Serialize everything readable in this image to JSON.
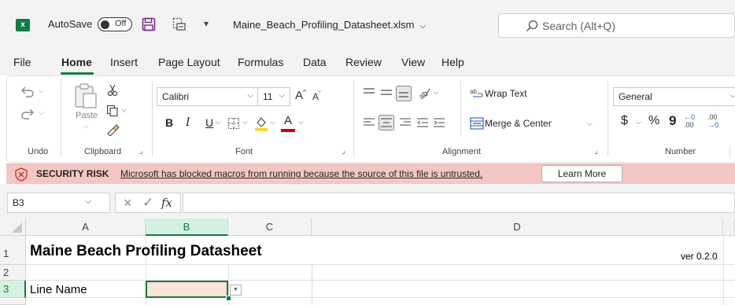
{
  "titlebar": {
    "app_icon": "excel-icon",
    "app_letter": "x",
    "autosave_label": "AutoSave",
    "toggle_state": "Off",
    "qat_dropdown": "▾",
    "filename": "Maine_Beach_Profiling_Datasheet.xlsm",
    "filename_chevron": "⌵",
    "search_placeholder": "Search (Alt+Q)"
  },
  "tabs": [
    "File",
    "Home",
    "Insert",
    "Page Layout",
    "Formulas",
    "Data",
    "Review",
    "View",
    "Help"
  ],
  "active_tab": "Home",
  "ribbon": {
    "undo": {
      "label": "Undo"
    },
    "clipboard": {
      "label": "Clipboard",
      "paste_label": "Paste"
    },
    "font": {
      "label": "Font",
      "font_name": "Calibri",
      "font_size": "11",
      "bold": "B",
      "italic": "I",
      "underline": "U",
      "font_color_letter": "A",
      "grow": "A",
      "shrink": "A"
    },
    "alignment": {
      "label": "Alignment",
      "wrap_text": "Wrap Text",
      "merge_center": "Merge & Center"
    },
    "number": {
      "label": "Number",
      "format": "General",
      "currency": "$",
      "percent": "%",
      "comma": "9",
      "inc_decimal_top": "←0",
      "inc_decimal_bottom": ".00",
      "dec_decimal_top": ".00",
      "dec_decimal_bottom": "→0"
    }
  },
  "security_bar": {
    "title": "SECURITY RISK",
    "message": "Microsoft has blocked macros from running because the source of this file is untrusted.",
    "button": "Learn More"
  },
  "formula_bar": {
    "name_box": "B3",
    "fx_label": "fx",
    "formula": ""
  },
  "grid": {
    "columns": [
      "A",
      "B",
      "C",
      "D"
    ],
    "rows": [
      "1",
      "2",
      "3"
    ],
    "cells": {
      "A1": "Maine Beach Profiling Datasheet",
      "D1": "ver 0.2.0",
      "A3": "Line Name"
    },
    "selected_cell": "B3"
  },
  "colors": {
    "excel_green": "#107c41",
    "security_bar": "#f4c7c4",
    "selected_cell_fill": "#fce4d6",
    "chrome_bg": "#f3f3f3"
  }
}
